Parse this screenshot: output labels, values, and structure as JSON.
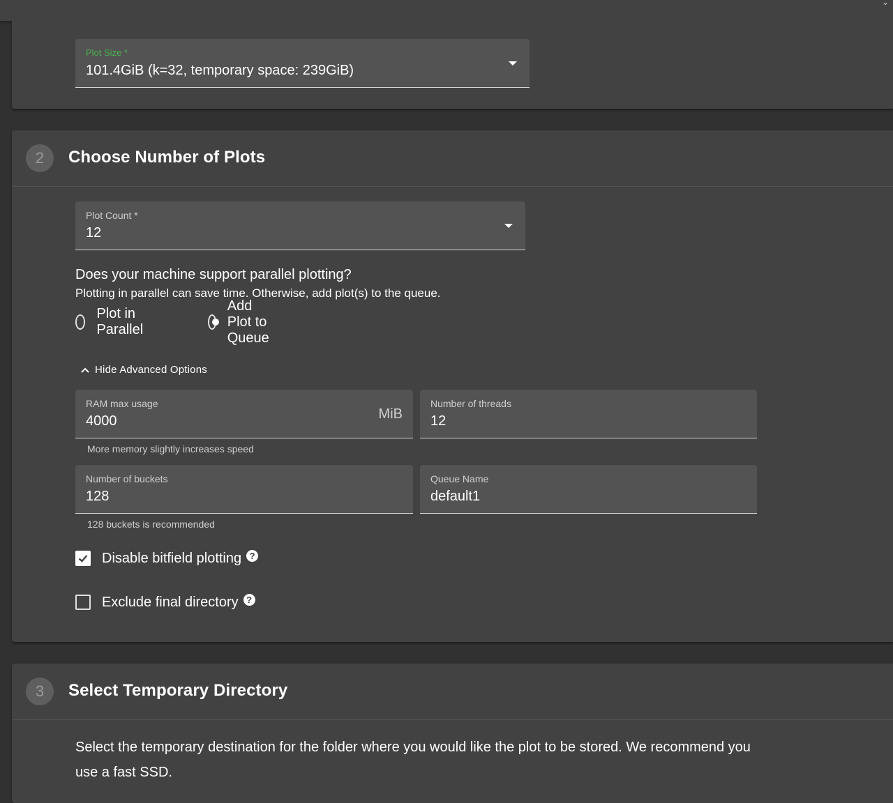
{
  "plot_size": {
    "label": "Plot Size *",
    "value": "101.4GiB (k=32, temporary space: 239GiB)"
  },
  "step2": {
    "number": "2",
    "title": "Choose Number of Plots",
    "plot_count": {
      "label": "Plot Count *",
      "value": "12"
    },
    "parallel_question": "Does your machine support parallel plotting?",
    "parallel_help": "Plotting in parallel can save time. Otherwise, add plot(s) to the queue.",
    "radio_options": [
      {
        "label": "Plot in Parallel",
        "checked": false
      },
      {
        "label": "Add Plot to Queue",
        "checked": true
      }
    ],
    "advanced_toggle": "Hide Advanced Options",
    "ram": {
      "label": "RAM max usage",
      "value": "4000",
      "unit": "MiB",
      "helper": "More memory slightly increases speed"
    },
    "threads": {
      "label": "Number of threads",
      "value": "12"
    },
    "buckets": {
      "label": "Number of buckets",
      "value": "128",
      "helper": "128 buckets is recommended"
    },
    "queue_name": {
      "label": "Queue Name",
      "value": "default1"
    },
    "disable_bitfield": {
      "label": "Disable bitfield plotting",
      "checked": true,
      "help_icon": "question-circle-icon"
    },
    "exclude_final": {
      "label": "Exclude final directory",
      "checked": false,
      "help_icon": "question-circle-icon"
    }
  },
  "step3": {
    "number": "3",
    "title": "Select Temporary Directory",
    "description": "Select the temporary destination for the folder where you would like the plot to be stored. We recommend you use a fast SSD."
  },
  "colors": {
    "background": "#313131",
    "card": "#424242",
    "field": "#535353",
    "focused_label": "#4caf50"
  }
}
